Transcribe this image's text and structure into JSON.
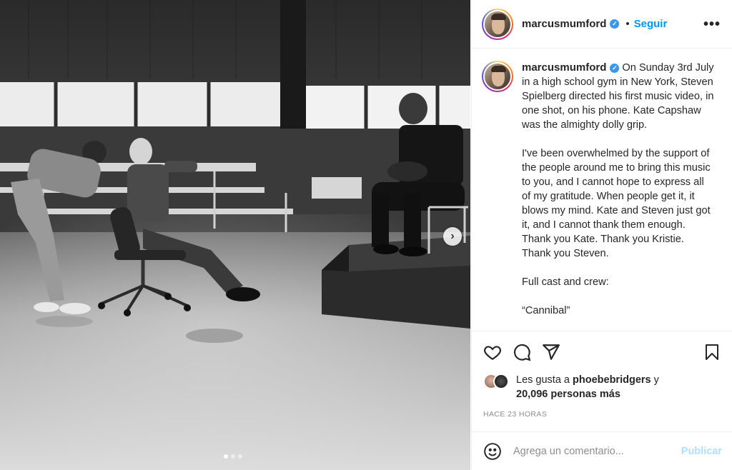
{
  "post": {
    "username": "marcusmumford",
    "follow_label": "Seguir",
    "bullet": "•",
    "more_label": "•••",
    "verified_mark": "✓",
    "caption_paragraphs": [
      "On Sunday 3rd July in a high school gym in New York, Steven Spielberg directed his first music video, in one shot, on his phone. Kate Capshaw was the almighty dolly grip.",
      "I've been overwhelmed by the support of the people around me to bring this music to you, and I cannot hope to express all of my gratitude. When people get it, it blows my mind. Kate and Steven just got it, and I cannot thank them enough. Thank you Kate. Thank you Kristie. Thank you Steven.",
      "Full cast and crew:",
      "“Cannibal”"
    ],
    "likes_prefix": "Les gusta a",
    "liked_by_user": "phoebebridgers",
    "likes_joiner": "y",
    "likes_count_text": "20,096 personas más",
    "timestamp": "HACE 23 HORAS"
  },
  "media": {
    "next_arrow": "›",
    "carousel_total": 3,
    "carousel_active": 1
  },
  "comment": {
    "placeholder": "Agrega un comentario...",
    "publish_label": "Publicar"
  },
  "colors": {
    "accent": "#0095f6",
    "publish_disabled": "#b2dffc",
    "verified": "#3897f0"
  },
  "icons": [
    "heart-icon",
    "comment-icon",
    "share-icon",
    "bookmark-icon",
    "emoji-icon",
    "verified-icon",
    "more-icon"
  ]
}
